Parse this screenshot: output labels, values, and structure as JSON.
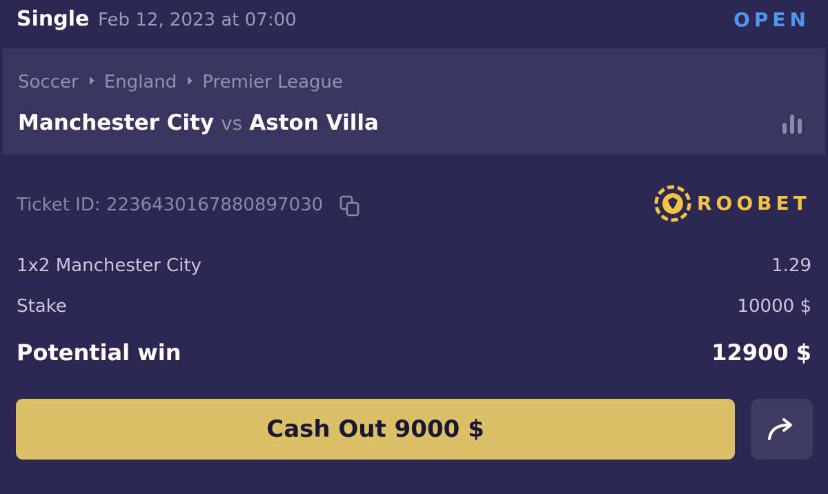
{
  "header": {
    "bet_type": "Single",
    "date": "Feb 12, 2023 at 07:00",
    "status": "OPEN"
  },
  "event": {
    "breadcrumb": [
      "Soccer",
      "England",
      "Premier League"
    ],
    "home_team": "Manchester City",
    "vs": "vs",
    "away_team": "Aston Villa",
    "stats_icon": "bar-chart-icon"
  },
  "ticket": {
    "label": "Ticket ID: 2236430167880897030",
    "copy_icon": "copy-icon"
  },
  "brand": {
    "logo_text": "ROOBET",
    "color": "#f3c444"
  },
  "selection": {
    "market": "1x2 Manchester City",
    "odds": "1.29"
  },
  "stake": {
    "label": "Stake",
    "value": "10000 $"
  },
  "potential_win": {
    "label": "Potential win",
    "value": "12900 $"
  },
  "actions": {
    "cashout_label": "Cash Out 9000 $",
    "share_icon": "share-arrow-icon"
  },
  "colors": {
    "background": "#2c2852",
    "card": "#3a355e",
    "status": "#4f96f0",
    "cashout": "#dcc068"
  }
}
